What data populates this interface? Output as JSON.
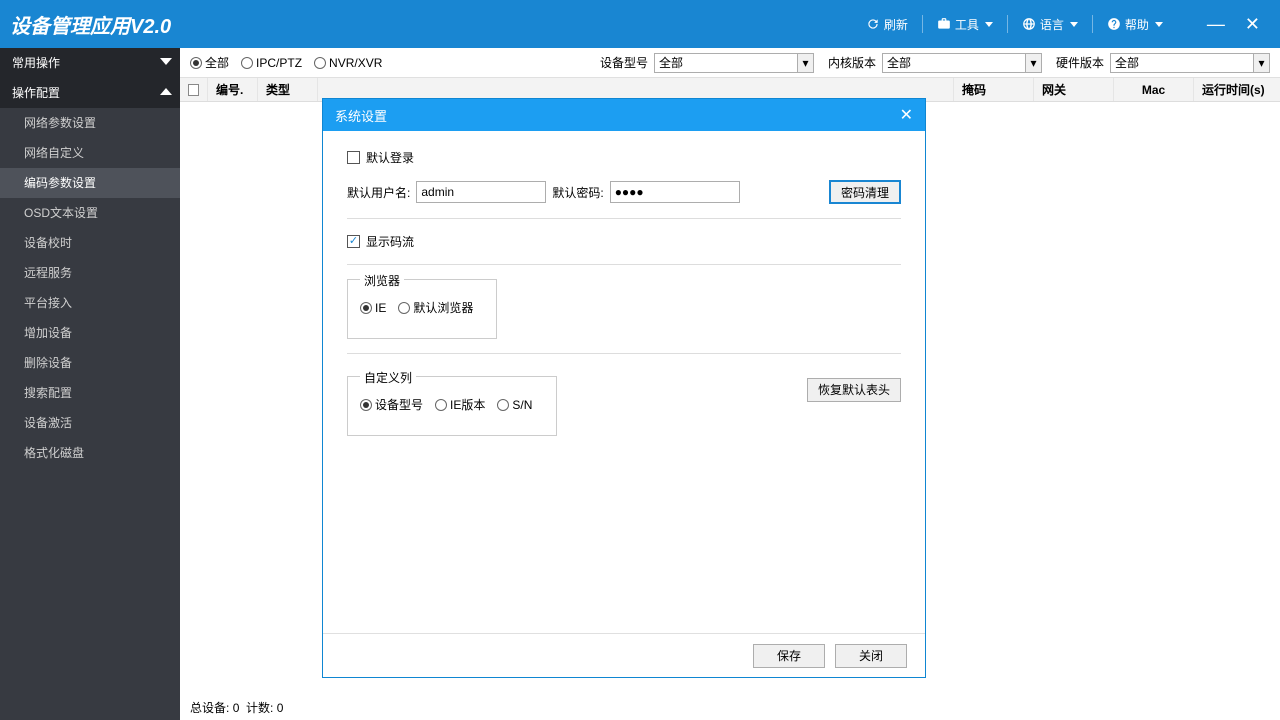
{
  "titlebar": {
    "title": "设备管理应用V2.0",
    "refresh": "刷新",
    "tools": "工具",
    "language": "语言",
    "help": "帮助"
  },
  "sidebar": {
    "group1": "常用操作",
    "group2": "操作配置",
    "items": [
      "网络参数设置",
      "网络自定义",
      "编码参数设置",
      "OSD文本设置",
      "设备校时",
      "远程服务",
      "平台接入",
      "增加设备",
      "删除设备",
      "搜索配置",
      "设备激活",
      "格式化磁盘"
    ],
    "active_index": 2
  },
  "filters": {
    "radios": {
      "all": "全部",
      "ipc": "IPC/PTZ",
      "nvr": "NVR/XVR"
    },
    "model_label": "设备型号",
    "model_val": "全部",
    "kernel_label": "内核版本",
    "kernel_val": "全部",
    "hw_label": "硬件版本",
    "hw_val": "全部"
  },
  "grid": {
    "cols": {
      "idx": "编号.",
      "type": "类型",
      "mask": "掩码",
      "gateway": "网关",
      "mac": "Mac",
      "runtime": "运行时间(s)"
    }
  },
  "status": {
    "total_label": "总设备:",
    "total": "0",
    "count_label": "计数:",
    "count": "0"
  },
  "modal": {
    "title": "系统设置",
    "auto_login": "默认登录",
    "user_label": "默认用户名:",
    "user_val": "admin",
    "pass_label": "默认密码:",
    "pass_val": "●●●●",
    "clear_pwd": "密码清理",
    "show_stream": "显示码流",
    "browser_legend": "浏览器",
    "browser_ie": "IE",
    "browser_default": "默认浏览器",
    "custom_legend": "自定义列",
    "col_model": "设备型号",
    "col_ie": "IE版本",
    "col_sn": "S/N",
    "reset_header": "恢复默认表头",
    "save": "保存",
    "close": "关闭"
  }
}
